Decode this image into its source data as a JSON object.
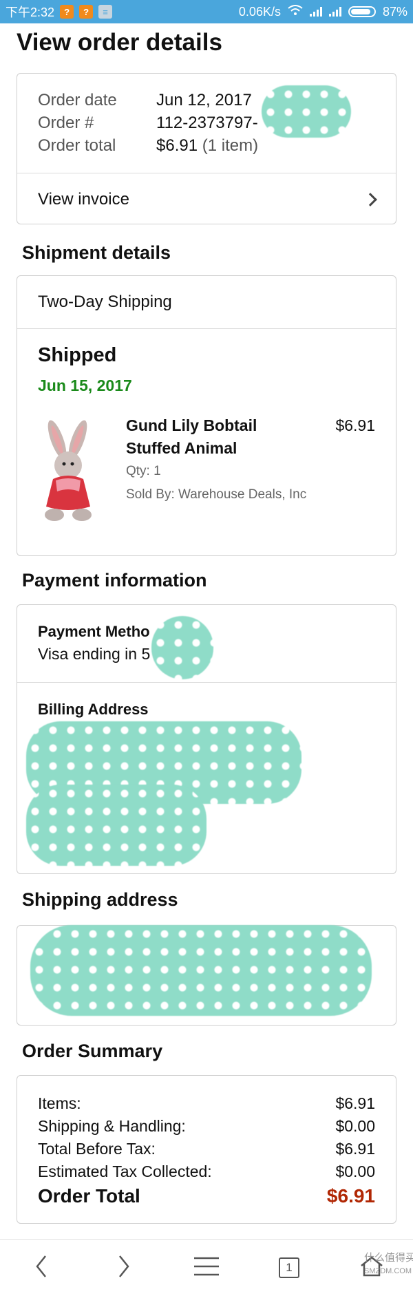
{
  "status_bar": {
    "time": "下午2:32",
    "speed": "0.06K/s",
    "battery": "87%"
  },
  "page_title": "View order details",
  "order": {
    "date_label": "Order date",
    "date_value": "Jun 12, 2017",
    "number_label": "Order #",
    "number_value": "112-2373797-",
    "total_label": "Order total",
    "total_value": "$6.91",
    "total_items": "(1 item)",
    "view_invoice": "View invoice"
  },
  "shipment": {
    "section_title": "Shipment details",
    "method": "Two-Day Shipping",
    "status": "Shipped",
    "status_date": "Jun 15, 2017",
    "item": {
      "name_line1": "Gund Lily Bobtail",
      "name_line2": "Stuffed Animal",
      "price": "$6.91",
      "qty": "Qty: 1",
      "seller": "Sold By: Warehouse Deals, Inc"
    }
  },
  "payment": {
    "section_title": "Payment information",
    "method_label": "Payment Metho",
    "method_value": "Visa ending in 5",
    "billing_label": "Billing Address"
  },
  "shipping_address": {
    "section_title": "Shipping address"
  },
  "summary": {
    "section_title": "Order Summary",
    "rows": [
      {
        "label": "Items:",
        "value": "$6.91"
      },
      {
        "label": "Shipping & Handling:",
        "value": "$0.00"
      },
      {
        "label": "Total Before Tax:",
        "value": "$6.91"
      },
      {
        "label": "Estimated Tax Collected:",
        "value": "$0.00"
      }
    ],
    "total_label": "Order Total",
    "total_value": "$6.91"
  },
  "bottom_nav": {
    "tab_count": "1",
    "watermark": "什么值得买",
    "watermark_sub": "SMZDM.COM"
  },
  "colors": {
    "status_bar": "#4aa6dc",
    "shipped_date": "#1a8a1a",
    "order_total": "#b12704",
    "redaction": "#8fdcc8"
  }
}
